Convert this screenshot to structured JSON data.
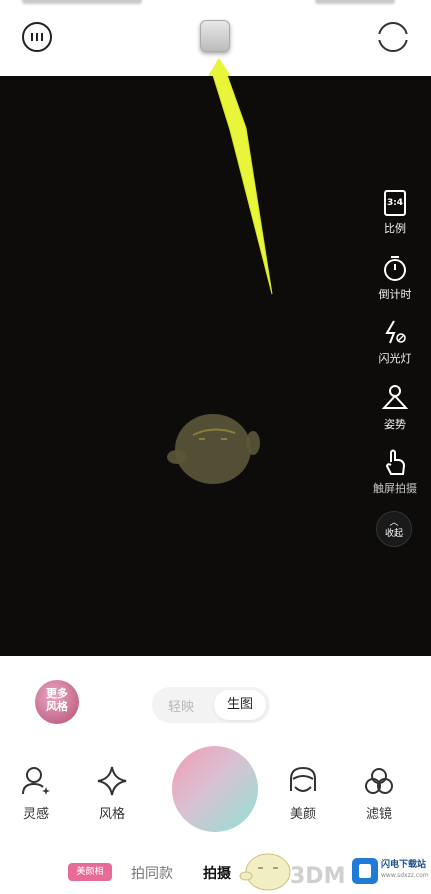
{
  "header": {
    "menu_icon": "more-options-icon",
    "thumbnail": "gallery-thumbnail",
    "switch_icon": "camera-switch-icon"
  },
  "side_tools": [
    {
      "name": "ratio",
      "icon_text": "3:4",
      "label": "比例"
    },
    {
      "name": "timer",
      "label": "倒计时"
    },
    {
      "name": "flash",
      "label": "闪光灯"
    },
    {
      "name": "pose",
      "label": "姿势"
    },
    {
      "name": "touch-shoot",
      "label": "触屏拍摄"
    }
  ],
  "collapse": {
    "label": "收起"
  },
  "style_pack": {
    "label_line1": "更多",
    "label_line2": "风格"
  },
  "mode_toggle": {
    "option_a": "轻映",
    "option_b": "生图"
  },
  "bottom_tools": [
    {
      "name": "inspiration",
      "label": "灵感"
    },
    {
      "name": "style",
      "label": "风格"
    },
    {
      "name": "beauty",
      "label": "美颜"
    },
    {
      "name": "filter",
      "label": "滤镜"
    }
  ],
  "tabs": {
    "badge": "美颜相",
    "tab1": "拍同款",
    "tab2": "拍摄"
  },
  "watermark": {
    "text": "3DM",
    "site_name": "闪电下载站",
    "site_url": "www.sdxzz.com"
  },
  "colors": {
    "viewfinder": "#0d0c0b",
    "arrow": "#e8f53a",
    "shutter_pink": "#f39ab5",
    "shutter_teal": "#8fe3d4",
    "badge": "#e66b98"
  }
}
